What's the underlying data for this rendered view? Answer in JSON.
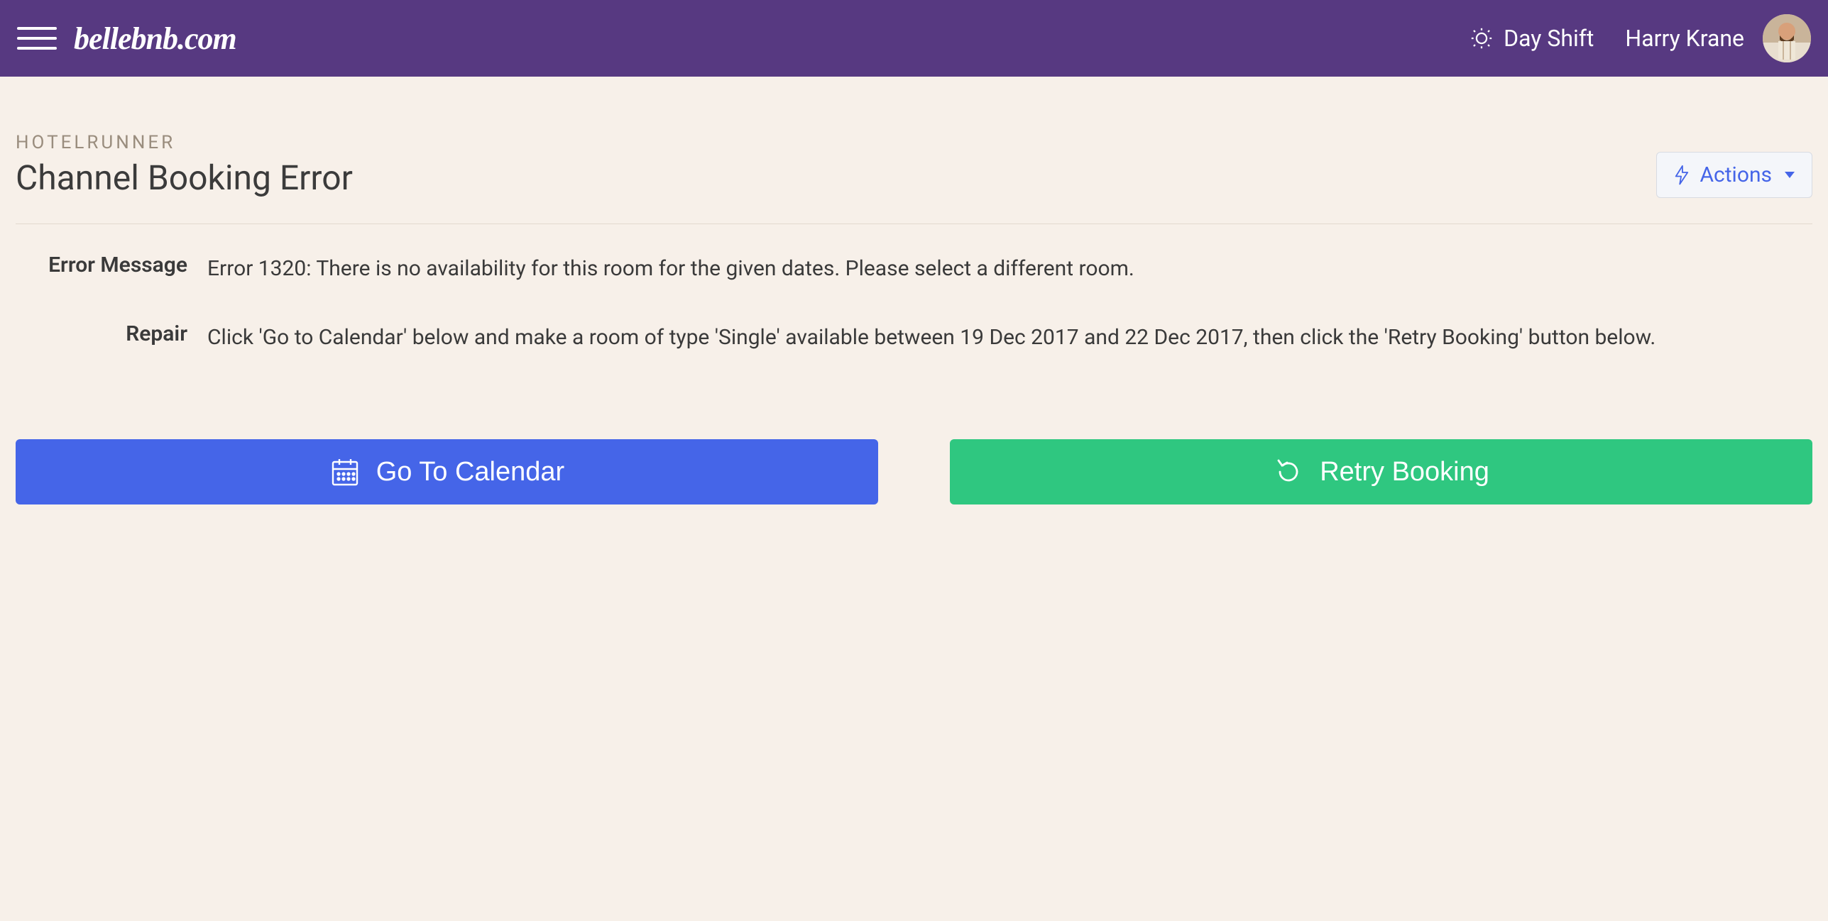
{
  "header": {
    "brand": "bellebnb.com",
    "shift_label": "Day Shift",
    "user_name": "Harry Krane"
  },
  "page": {
    "eyebrow": "HOTELRUNNER",
    "title": "Channel Booking Error",
    "actions_label": "Actions"
  },
  "fields": {
    "error_label": "Error Message",
    "error_value": "Error 1320: There is no availability for this room for the given dates. Please select a different room.",
    "repair_label": "Repair",
    "repair_value": "Click 'Go to Calendar' below and make a room of type 'Single' available between 19 Dec 2017 and 22 Dec 2017, then click the 'Retry Booking' button below."
  },
  "buttons": {
    "calendar_label": "Go To Calendar",
    "retry_label": "Retry Booking"
  }
}
